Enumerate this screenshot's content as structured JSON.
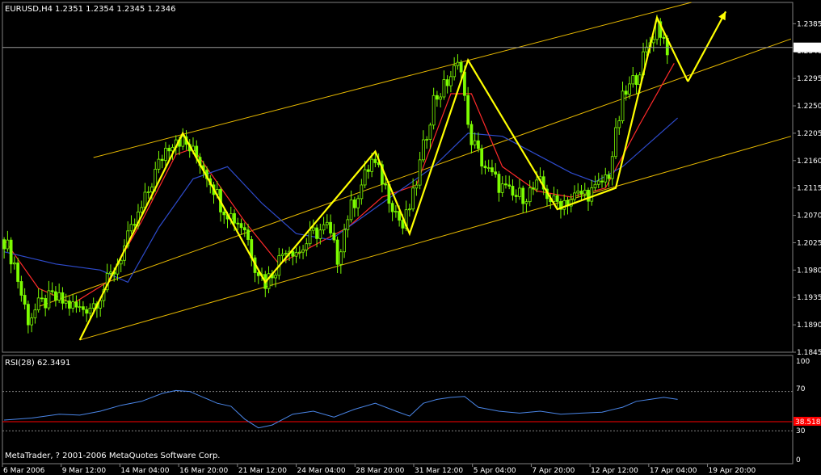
{
  "header": {
    "symbol": "EURUSD,H4",
    "ohlc": "1.2351 1.2354 1.2345 1.2346"
  },
  "rsi_panel": {
    "label": "RSI(28) 62.3491",
    "levels": [
      "100",
      "70",
      "30",
      "0"
    ],
    "current_badge": "38.5188"
  },
  "footer": {
    "copyright": "MetaTrader, ? 2001-2006 MetaQuotes Software Corp."
  },
  "colors": {
    "background": "#000000",
    "bullish": "#7CFC00",
    "zigzag": "#FFFF00",
    "channel": "#E6B800",
    "ma_fast": "#FF2A2A",
    "ma_slow": "#2E4BCC",
    "rsi_line": "#4A86E8",
    "rsi_level": "#FF0000",
    "grid": "#808080",
    "current_price_badge_bg": "#FFFFFF"
  },
  "chart_data": [
    {
      "type": "candlestick",
      "title": "EURUSD,H4",
      "price_axis": {
        "ticks": [
          "1.2385",
          "1.2340",
          "1.2295",
          "1.2250",
          "1.2205",
          "1.2160",
          "1.2115",
          "1.2070",
          "1.2025",
          "1.1980",
          "1.1935",
          "1.1890",
          "1.1845"
        ],
        "range": [
          1.1845,
          1.242
        ],
        "current_price": "1.2346"
      },
      "time_axis": {
        "ticks": [
          "6 Mar 2006",
          "9 Mar 12:00",
          "14 Mar 04:00",
          "16 Mar 20:00",
          "21 Mar 12:00",
          "24 Mar 04:00",
          "28 Mar 20:00",
          "31 Mar 12:00",
          "5 Apr 04:00",
          "7 Apr 20:00",
          "12 Apr 12:00",
          "17 Apr 04:00",
          "19 Apr 20:00"
        ],
        "bars_total": 230
      },
      "close_path": [
        [
          0,
          1.203
        ],
        [
          3,
          1.199
        ],
        [
          5,
          1.194
        ],
        [
          7,
          1.19
        ],
        [
          10,
          1.192
        ],
        [
          14,
          1.1935
        ],
        [
          18,
          1.1925
        ],
        [
          22,
          1.1915
        ],
        [
          26,
          1.1925
        ],
        [
          28,
          1.194
        ],
        [
          32,
          1.198
        ],
        [
          36,
          1.203
        ],
        [
          40,
          1.208
        ],
        [
          44,
          1.214
        ],
        [
          47,
          1.218
        ],
        [
          50,
          1.22
        ],
        [
          53,
          1.2185
        ],
        [
          57,
          1.216
        ],
        [
          60,
          1.213
        ],
        [
          63,
          1.209
        ],
        [
          66,
          1.207
        ],
        [
          70,
          1.205
        ],
        [
          73,
          1.199
        ],
        [
          76,
          1.196
        ],
        [
          79,
          1.1985
        ],
        [
          82,
          1.202
        ],
        [
          86,
          1.201
        ],
        [
          90,
          1.204
        ],
        [
          94,
          1.205
        ],
        [
          97,
          1.2
        ],
        [
          100,
          1.207
        ],
        [
          104,
          1.212
        ],
        [
          107,
          1.216
        ],
        [
          110,
          1.213
        ],
        [
          113,
          1.209
        ],
        [
          116,
          1.205
        ],
        [
          119,
          1.21
        ],
        [
          122,
          1.218
        ],
        [
          125,
          1.226
        ],
        [
          128,
          1.228
        ],
        [
          130,
          1.23
        ],
        [
          133,
          1.232
        ],
        [
          135,
          1.221
        ],
        [
          138,
          1.217
        ],
        [
          141,
          1.214
        ],
        [
          144,
          1.212
        ],
        [
          148,
          1.21
        ],
        [
          152,
          1.2105
        ],
        [
          156,
          1.212
        ],
        [
          160,
          1.209
        ],
        [
          164,
          1.2095
        ],
        [
          168,
          1.2105
        ],
        [
          172,
          1.211
        ],
        [
          176,
          1.214
        ],
        [
          180,
          1.226
        ],
        [
          184,
          1.23
        ],
        [
          187,
          1.234
        ],
        [
          190,
          1.2385
        ],
        [
          193,
          1.2346
        ]
      ],
      "series": [
        {
          "name": "",
          "role": "moving-average-fast",
          "color": "#FF2A2A",
          "points": [
            [
              0,
              1.203
            ],
            [
              10,
              1.195
            ],
            [
              20,
              1.1925
            ],
            [
              30,
              1.196
            ],
            [
              40,
              1.206
            ],
            [
              50,
              1.217
            ],
            [
              55,
              1.218
            ],
            [
              60,
              1.214
            ],
            [
              70,
              1.206
            ],
            [
              80,
              1.199
            ],
            [
              90,
              1.202
            ],
            [
              100,
              1.205
            ],
            [
              110,
              1.21
            ],
            [
              120,
              1.212
            ],
            [
              130,
              1.227
            ],
            [
              136,
              1.227
            ],
            [
              145,
              1.215
            ],
            [
              155,
              1.211
            ],
            [
              165,
              1.21
            ],
            [
              175,
              1.2115
            ],
            [
              185,
              1.222
            ],
            [
              195,
              1.232
            ]
          ]
        },
        {
          "name": "",
          "role": "moving-average-slow",
          "color": "#2E4BCC",
          "points": [
            [
              0,
              1.201
            ],
            [
              15,
              1.199
            ],
            [
              28,
              1.198
            ],
            [
              36,
              1.196
            ],
            [
              45,
              1.205
            ],
            [
              55,
              1.213
            ],
            [
              65,
              1.215
            ],
            [
              75,
              1.209
            ],
            [
              85,
              1.204
            ],
            [
              95,
              1.203
            ],
            [
              105,
              1.207
            ],
            [
              115,
              1.211
            ],
            [
              125,
              1.215
            ],
            [
              135,
              1.2205
            ],
            [
              145,
              1.22
            ],
            [
              155,
              1.217
            ],
            [
              165,
              1.214
            ],
            [
              172,
              1.2125
            ],
            [
              180,
              1.215
            ],
            [
              190,
              1.22
            ],
            [
              196,
              1.223
            ]
          ]
        },
        {
          "name": "",
          "role": "zigzag",
          "color": "#FFFF00",
          "points": [
            [
              22,
              1.1865
            ],
            [
              52,
              1.2205
            ],
            [
              76,
              1.196
            ],
            [
              108,
              1.2175
            ],
            [
              118,
              1.204
            ],
            [
              135,
              1.2325
            ],
            [
              161,
              1.208
            ],
            [
              178,
              1.2115
            ],
            [
              190,
              1.2395
            ],
            [
              199,
              1.229
            ]
          ]
        },
        {
          "name": "",
          "role": "projection-arrow",
          "color": "#FFFF00",
          "points": [
            [
              199,
              1.229
            ],
            [
              210,
              1.2405
            ]
          ]
        }
      ],
      "channel_lines": [
        {
          "role": "upper",
          "from": [
            26,
            1.2165
          ],
          "to": [
            200,
            1.242
          ]
        },
        {
          "role": "middle",
          "from": [
            10,
            1.192
          ],
          "to": [
            229,
            1.236
          ]
        },
        {
          "role": "lower",
          "from": [
            22,
            1.1865
          ],
          "to": [
            229,
            1.22
          ]
        }
      ],
      "xlabel": "",
      "ylabel": ""
    },
    {
      "type": "line",
      "title": "RSI(28) 62.3491",
      "ylim": [
        0,
        100
      ],
      "levels": [
        70,
        30
      ],
      "series": [
        {
          "name": "",
          "color": "#4A86E8",
          "points": [
            [
              0,
              41
            ],
            [
              8,
              43
            ],
            [
              16,
              47
            ],
            [
              22,
              46
            ],
            [
              28,
              50
            ],
            [
              34,
              56
            ],
            [
              40,
              60
            ],
            [
              46,
              68
            ],
            [
              50,
              71
            ],
            [
              54,
              70
            ],
            [
              58,
              64
            ],
            [
              62,
              58
            ],
            [
              66,
              55
            ],
            [
              70,
              42
            ],
            [
              74,
              33
            ],
            [
              78,
              36
            ],
            [
              84,
              47
            ],
            [
              90,
              50
            ],
            [
              96,
              44
            ],
            [
              102,
              52
            ],
            [
              108,
              58
            ],
            [
              114,
              50
            ],
            [
              118,
              45
            ],
            [
              122,
              58
            ],
            [
              126,
              62
            ],
            [
              130,
              64
            ],
            [
              134,
              65
            ],
            [
              138,
              54
            ],
            [
              144,
              50
            ],
            [
              150,
              48
            ],
            [
              156,
              50
            ],
            [
              162,
              47
            ],
            [
              168,
              48
            ],
            [
              174,
              49
            ],
            [
              180,
              54
            ],
            [
              184,
              60
            ],
            [
              188,
              62
            ],
            [
              192,
              64
            ],
            [
              196,
              62
            ]
          ]
        }
      ]
    }
  ]
}
